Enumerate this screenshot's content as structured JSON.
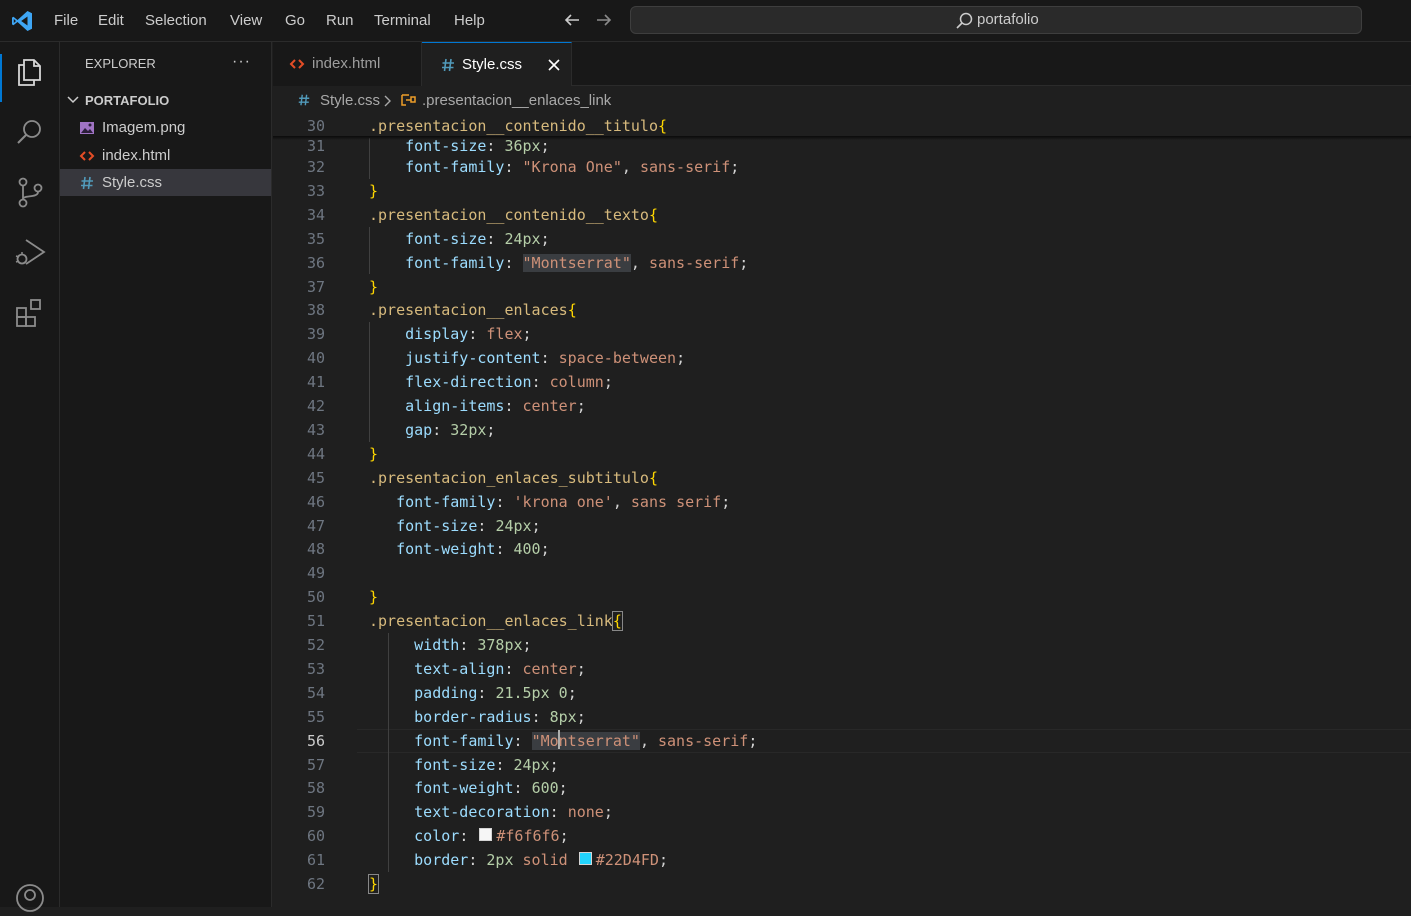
{
  "menu": [
    "File",
    "Edit",
    "Selection",
    "View",
    "Go",
    "Run",
    "Terminal",
    "Help"
  ],
  "search": {
    "text": "portafolio"
  },
  "sidebar": {
    "title": "EXPLORER",
    "more": "···",
    "folder": "PORTAFOLIO",
    "files": [
      {
        "name": "Imagem.png",
        "icon": "image-file-icon"
      },
      {
        "name": "index.html",
        "icon": "html-file-icon"
      },
      {
        "name": "Style.css",
        "icon": "css-file-icon",
        "selected": true
      }
    ]
  },
  "tabs": [
    {
      "label": "index.html",
      "icon": "html-file-icon"
    },
    {
      "label": "Style.css",
      "icon": "css-file-icon",
      "active": true
    }
  ],
  "breadcrumb": {
    "file": "Style.css",
    "symbol": ".presentacion__enlaces_link"
  },
  "editor": {
    "current_line": "56",
    "lines": [
      {
        "n": "30",
        "t": ".presentacion__contenido__titulo{"
      },
      {
        "n": "31",
        "t": "    font-size: 36px;"
      },
      {
        "n": "32",
        "t": "    font-family: \"Krona One\", sans-serif;"
      },
      {
        "n": "33",
        "t": "}"
      },
      {
        "n": "34",
        "t": ".presentacion__contenido__texto{"
      },
      {
        "n": "35",
        "t": "    font-size: 24px;"
      },
      {
        "n": "36",
        "t": "    font-family: \"Montserrat\", sans-serif;"
      },
      {
        "n": "37",
        "t": "}"
      },
      {
        "n": "38",
        "t": ".presentacion__enlaces{"
      },
      {
        "n": "39",
        "t": "    display: flex;"
      },
      {
        "n": "40",
        "t": "    justify-content: space-between;"
      },
      {
        "n": "41",
        "t": "    flex-direction: column;"
      },
      {
        "n": "42",
        "t": "    align-items: center;"
      },
      {
        "n": "43",
        "t": "    gap: 32px;"
      },
      {
        "n": "44",
        "t": "}"
      },
      {
        "n": "45",
        "t": ".presentacion_enlaces_subtitulo{"
      },
      {
        "n": "46",
        "t": "   font-family: 'krona one', sans serif;"
      },
      {
        "n": "47",
        "t": "   font-size: 24px;"
      },
      {
        "n": "48",
        "t": "   font-weight: 400;"
      },
      {
        "n": "49",
        "t": ""
      },
      {
        "n": "50",
        "t": "}"
      },
      {
        "n": "51",
        "t": ".presentacion__enlaces_link{"
      },
      {
        "n": "52",
        "t": "     width: 378px;"
      },
      {
        "n": "53",
        "t": "     text-align: center;"
      },
      {
        "n": "54",
        "t": "     padding: 21.5px 0;"
      },
      {
        "n": "55",
        "t": "     border-radius: 8px;"
      },
      {
        "n": "56",
        "t": "     font-family: \"Montserrat\", sans-serif;"
      },
      {
        "n": "57",
        "t": "     font-size: 24px;"
      },
      {
        "n": "58",
        "t": "     font-weight: 600;"
      },
      {
        "n": "59",
        "t": "     text-decoration: none;"
      },
      {
        "n": "60",
        "t": "     color: #f6f6f6;"
      },
      {
        "n": "61",
        "t": "     border: 2px solid #22D4FD;"
      },
      {
        "n": "62",
        "t": "}"
      }
    ]
  },
  "colors": {
    "accent": "#0078d4",
    "swatch_color": "#f6f6f6",
    "swatch_border": "#22D4FD"
  }
}
